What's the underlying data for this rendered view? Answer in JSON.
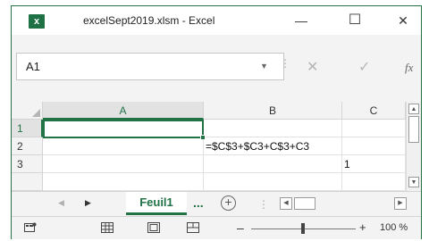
{
  "window": {
    "title": "excelSept2019.xlsm  -  Excel",
    "app_icon_label": "x",
    "minimize_glyph": "—",
    "maximize_glyph": "☐",
    "close_glyph": "✕"
  },
  "formula_bar": {
    "name_box_value": "A1",
    "name_box_dropdown_glyph": "▼",
    "separator_glyph": "⋮",
    "cancel_glyph": "✕",
    "enter_glyph": "✓",
    "function_label": "fx"
  },
  "grid": {
    "columns": [
      "A",
      "B",
      "C"
    ],
    "rows": [
      {
        "number": "1",
        "cells": [
          "",
          "",
          ""
        ]
      },
      {
        "number": "2",
        "cells": [
          "",
          "=$C$3+$C3+C$3+C3",
          ""
        ]
      },
      {
        "number": "3",
        "cells": [
          "",
          "",
          "1"
        ]
      }
    ],
    "active_cell": "A1"
  },
  "sheet_tabs": {
    "prev_glyph": "◀",
    "next_glyph": "▶",
    "active_tab": "Feuil1",
    "more_glyph": "...",
    "add_glyph": "+"
  },
  "status_bar": {
    "zoom_minus": "–",
    "zoom_plus": "+",
    "zoom_level": "100 %",
    "zoom_level_value": 100
  },
  "colors": {
    "accent": "#217346",
    "icon_bg": "#1e7145"
  },
  "icons": {
    "app": "excel-icon",
    "normal_view": "grid-view-icon",
    "page_layout": "page-layout-icon",
    "page_break": "page-break-icon",
    "macro": "macro-recording-icon"
  }
}
